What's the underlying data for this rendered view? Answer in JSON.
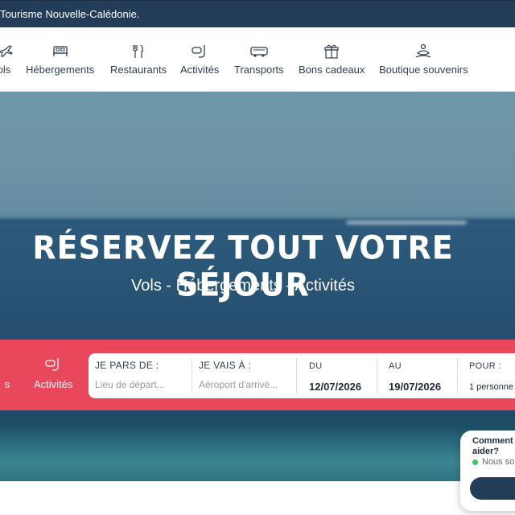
{
  "topbar": {
    "text": "Tourisme Nouvelle-Calédonie."
  },
  "nav": {
    "items": [
      {
        "label": "ols",
        "icon": "plane-icon"
      },
      {
        "label": "Hébergements",
        "icon": "bed-icon"
      },
      {
        "label": "Restaurants",
        "icon": "cutlery-icon"
      },
      {
        "label": "Activités",
        "icon": "snorkel-icon"
      },
      {
        "label": "Transports",
        "icon": "bus-icon"
      },
      {
        "label": "Bons cadeaux",
        "icon": "gift-icon"
      },
      {
        "label": "Boutique souvenirs",
        "icon": "souvenir-icon"
      }
    ]
  },
  "hero": {
    "title": "RÉSERVEZ TOUT VOTRE SÉJOUR",
    "subtitle": "Vols - Hébergements - Activités"
  },
  "search": {
    "tabs": [
      {
        "label": "s"
      },
      {
        "label": "Activités",
        "icon": "snorkel-icon"
      }
    ],
    "from": {
      "label": "JE PARS DE :",
      "placeholder": "Lieu de départ..."
    },
    "to": {
      "label": "JE VAIS À :",
      "placeholder": "Aéroport d'arrivé..."
    },
    "date_from": {
      "label": "DU",
      "value": "12/07/2026"
    },
    "date_to": {
      "label": "AU",
      "value": "19/07/2026"
    },
    "pax": {
      "label": "POUR :",
      "value": "1 personne"
    }
  },
  "chat": {
    "title": "Comment aider?",
    "status": "Nous so"
  },
  "colors": {
    "topbar": "#233c57",
    "accent": "#e9475b",
    "nav_text": "#2f3f52"
  }
}
